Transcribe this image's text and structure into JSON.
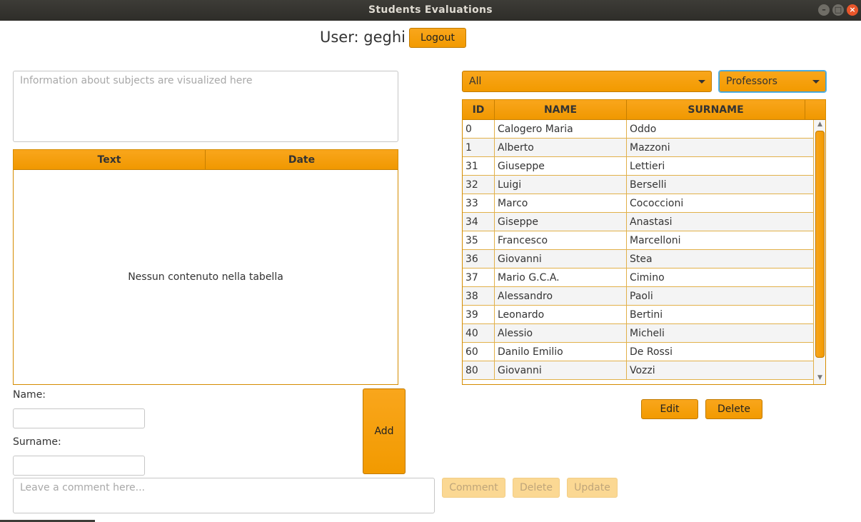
{
  "window": {
    "title": "Students Evaluations"
  },
  "header": {
    "user_label": "User: geghi",
    "logout_label": "Logout"
  },
  "subjects_info": {
    "placeholder": "Information about subjects are visualized here"
  },
  "comments_table": {
    "columns": [
      "Text",
      "Date"
    ],
    "empty_message": "Nessun contenuto nella tabella"
  },
  "form": {
    "name_label": "Name:",
    "surname_label": "Surname:",
    "name_value": "",
    "surname_value": "",
    "add_label": "Add"
  },
  "comment": {
    "placeholder": "Leave a comment here...",
    "comment_label": "Comment",
    "delete_label": "Delete",
    "update_label": "Update"
  },
  "filters": {
    "first_value": "All",
    "second_value": "Professors"
  },
  "professors_table": {
    "columns": [
      "ID",
      "NAME",
      "SURNAME"
    ],
    "rows": [
      {
        "id": "0",
        "name": "Calogero Maria",
        "surname": "Oddo"
      },
      {
        "id": "1",
        "name": "Alberto",
        "surname": "Mazzoni"
      },
      {
        "id": "31",
        "name": "Giuseppe",
        "surname": "Lettieri"
      },
      {
        "id": "32",
        "name": "Luigi",
        "surname": "Berselli"
      },
      {
        "id": "33",
        "name": "Marco",
        "surname": "Cococcioni"
      },
      {
        "id": "34",
        "name": "Giseppe",
        "surname": "Anastasi"
      },
      {
        "id": "35",
        "name": "Francesco",
        "surname": "Marcelloni"
      },
      {
        "id": "36",
        "name": "Giovanni",
        "surname": "Stea"
      },
      {
        "id": "37",
        "name": "Mario G.C.A.",
        "surname": "Cimino"
      },
      {
        "id": "38",
        "name": "Alessandro",
        "surname": "Paoli"
      },
      {
        "id": "39",
        "name": "Leonardo",
        "surname": "Bertini"
      },
      {
        "id": "40",
        "name": "Alessio",
        "surname": "Micheli"
      },
      {
        "id": "60",
        "name": "Danilo Emilio",
        "surname": "De Rossi"
      },
      {
        "id": "80",
        "name": "Giovanni",
        "surname": "Vozzi"
      }
    ]
  },
  "professor_actions": {
    "edit_label": "Edit",
    "delete_label": "Delete"
  },
  "colors": {
    "accent": "#f29a00",
    "border": "#c07a00",
    "focus": "#3ea1d9"
  }
}
